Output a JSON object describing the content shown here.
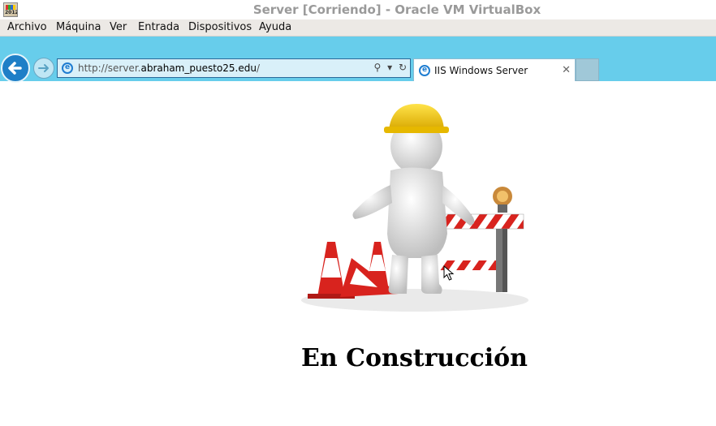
{
  "window": {
    "title": "Server [Corriendo] - Oracle VM VirtualBox",
    "icon": "virtualbox-app-icon",
    "icon_text": "2012"
  },
  "menubar": {
    "items": [
      "Archivo",
      "Máquina",
      "Ver",
      "Entrada",
      "Dispositivos",
      "Ayuda"
    ]
  },
  "browser": {
    "url_prefix": "http://server.",
    "url_domain": "abraham_puesto25.edu",
    "url_suffix": "/",
    "tab_title": "IIS Windows Server",
    "accent_color": "#67cdeb"
  },
  "page": {
    "heading": "En Construcción",
    "hero_image": "under-construction-figure"
  }
}
